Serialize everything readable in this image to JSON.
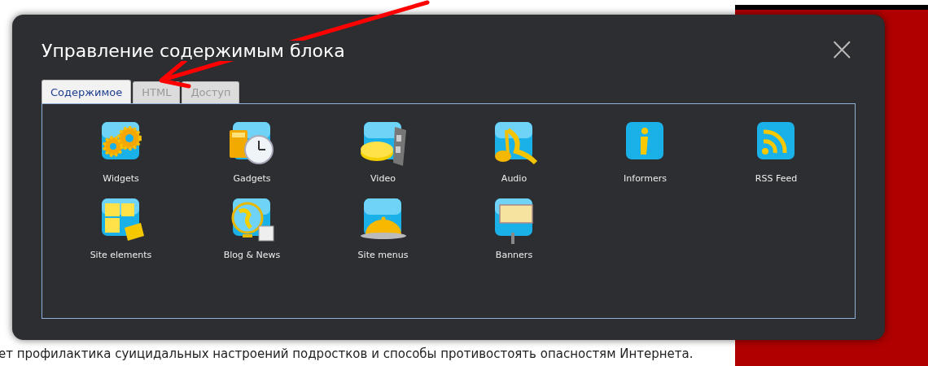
{
  "page": {
    "text_line": "ет профилактика суицидальных настроений подростков и способы противостоять опасностям Интернета."
  },
  "dialog": {
    "title": "Управление содержимым блока",
    "close": "×",
    "tabs": [
      {
        "label": "Содержимое",
        "selected": true
      },
      {
        "label": "HTML",
        "selected": false
      },
      {
        "label": "Доступ",
        "selected": false
      }
    ],
    "items": [
      {
        "label": "Widgets",
        "kind": "gears"
      },
      {
        "label": "Gadgets",
        "kind": "clock"
      },
      {
        "label": "Video",
        "kind": "film"
      },
      {
        "label": "Audio",
        "kind": "music"
      },
      {
        "label": "Informers",
        "kind": "info"
      },
      {
        "label": "RSS Feed",
        "kind": "rss"
      },
      {
        "label": "Site elements",
        "kind": "puzzle"
      },
      {
        "label": "Blog & News",
        "kind": "globe"
      },
      {
        "label": "Site menus",
        "kind": "cloche"
      },
      {
        "label": "Banners",
        "kind": "banner"
      }
    ]
  }
}
